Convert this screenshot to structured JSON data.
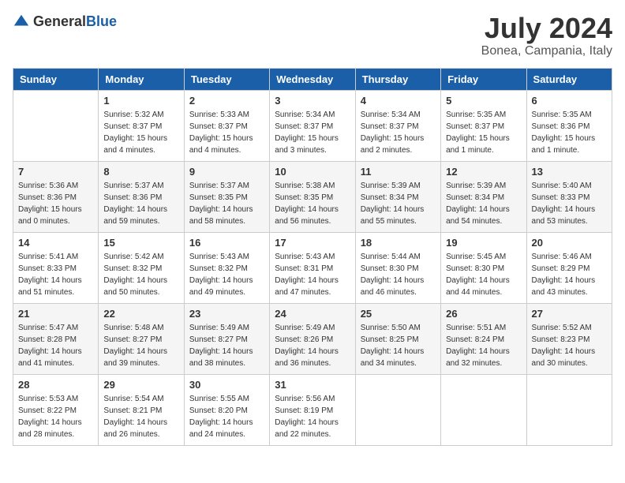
{
  "header": {
    "logo_general": "General",
    "logo_blue": "Blue",
    "month": "July 2024",
    "location": "Bonea, Campania, Italy"
  },
  "days_of_week": [
    "Sunday",
    "Monday",
    "Tuesday",
    "Wednesday",
    "Thursday",
    "Friday",
    "Saturday"
  ],
  "weeks": [
    [
      {
        "day": "",
        "sunrise": "",
        "sunset": "",
        "daylight": ""
      },
      {
        "day": "1",
        "sunrise": "Sunrise: 5:32 AM",
        "sunset": "Sunset: 8:37 PM",
        "daylight": "Daylight: 15 hours and 4 minutes."
      },
      {
        "day": "2",
        "sunrise": "Sunrise: 5:33 AM",
        "sunset": "Sunset: 8:37 PM",
        "daylight": "Daylight: 15 hours and 4 minutes."
      },
      {
        "day": "3",
        "sunrise": "Sunrise: 5:34 AM",
        "sunset": "Sunset: 8:37 PM",
        "daylight": "Daylight: 15 hours and 3 minutes."
      },
      {
        "day": "4",
        "sunrise": "Sunrise: 5:34 AM",
        "sunset": "Sunset: 8:37 PM",
        "daylight": "Daylight: 15 hours and 2 minutes."
      },
      {
        "day": "5",
        "sunrise": "Sunrise: 5:35 AM",
        "sunset": "Sunset: 8:37 PM",
        "daylight": "Daylight: 15 hours and 1 minute."
      },
      {
        "day": "6",
        "sunrise": "Sunrise: 5:35 AM",
        "sunset": "Sunset: 8:36 PM",
        "daylight": "Daylight: 15 hours and 1 minute."
      }
    ],
    [
      {
        "day": "7",
        "sunrise": "Sunrise: 5:36 AM",
        "sunset": "Sunset: 8:36 PM",
        "daylight": "Daylight: 15 hours and 0 minutes."
      },
      {
        "day": "8",
        "sunrise": "Sunrise: 5:37 AM",
        "sunset": "Sunset: 8:36 PM",
        "daylight": "Daylight: 14 hours and 59 minutes."
      },
      {
        "day": "9",
        "sunrise": "Sunrise: 5:37 AM",
        "sunset": "Sunset: 8:35 PM",
        "daylight": "Daylight: 14 hours and 58 minutes."
      },
      {
        "day": "10",
        "sunrise": "Sunrise: 5:38 AM",
        "sunset": "Sunset: 8:35 PM",
        "daylight": "Daylight: 14 hours and 56 minutes."
      },
      {
        "day": "11",
        "sunrise": "Sunrise: 5:39 AM",
        "sunset": "Sunset: 8:34 PM",
        "daylight": "Daylight: 14 hours and 55 minutes."
      },
      {
        "day": "12",
        "sunrise": "Sunrise: 5:39 AM",
        "sunset": "Sunset: 8:34 PM",
        "daylight": "Daylight: 14 hours and 54 minutes."
      },
      {
        "day": "13",
        "sunrise": "Sunrise: 5:40 AM",
        "sunset": "Sunset: 8:33 PM",
        "daylight": "Daylight: 14 hours and 53 minutes."
      }
    ],
    [
      {
        "day": "14",
        "sunrise": "Sunrise: 5:41 AM",
        "sunset": "Sunset: 8:33 PM",
        "daylight": "Daylight: 14 hours and 51 minutes."
      },
      {
        "day": "15",
        "sunrise": "Sunrise: 5:42 AM",
        "sunset": "Sunset: 8:32 PM",
        "daylight": "Daylight: 14 hours and 50 minutes."
      },
      {
        "day": "16",
        "sunrise": "Sunrise: 5:43 AM",
        "sunset": "Sunset: 8:32 PM",
        "daylight": "Daylight: 14 hours and 49 minutes."
      },
      {
        "day": "17",
        "sunrise": "Sunrise: 5:43 AM",
        "sunset": "Sunset: 8:31 PM",
        "daylight": "Daylight: 14 hours and 47 minutes."
      },
      {
        "day": "18",
        "sunrise": "Sunrise: 5:44 AM",
        "sunset": "Sunset: 8:30 PM",
        "daylight": "Daylight: 14 hours and 46 minutes."
      },
      {
        "day": "19",
        "sunrise": "Sunrise: 5:45 AM",
        "sunset": "Sunset: 8:30 PM",
        "daylight": "Daylight: 14 hours and 44 minutes."
      },
      {
        "day": "20",
        "sunrise": "Sunrise: 5:46 AM",
        "sunset": "Sunset: 8:29 PM",
        "daylight": "Daylight: 14 hours and 43 minutes."
      }
    ],
    [
      {
        "day": "21",
        "sunrise": "Sunrise: 5:47 AM",
        "sunset": "Sunset: 8:28 PM",
        "daylight": "Daylight: 14 hours and 41 minutes."
      },
      {
        "day": "22",
        "sunrise": "Sunrise: 5:48 AM",
        "sunset": "Sunset: 8:27 PM",
        "daylight": "Daylight: 14 hours and 39 minutes."
      },
      {
        "day": "23",
        "sunrise": "Sunrise: 5:49 AM",
        "sunset": "Sunset: 8:27 PM",
        "daylight": "Daylight: 14 hours and 38 minutes."
      },
      {
        "day": "24",
        "sunrise": "Sunrise: 5:49 AM",
        "sunset": "Sunset: 8:26 PM",
        "daylight": "Daylight: 14 hours and 36 minutes."
      },
      {
        "day": "25",
        "sunrise": "Sunrise: 5:50 AM",
        "sunset": "Sunset: 8:25 PM",
        "daylight": "Daylight: 14 hours and 34 minutes."
      },
      {
        "day": "26",
        "sunrise": "Sunrise: 5:51 AM",
        "sunset": "Sunset: 8:24 PM",
        "daylight": "Daylight: 14 hours and 32 minutes."
      },
      {
        "day": "27",
        "sunrise": "Sunrise: 5:52 AM",
        "sunset": "Sunset: 8:23 PM",
        "daylight": "Daylight: 14 hours and 30 minutes."
      }
    ],
    [
      {
        "day": "28",
        "sunrise": "Sunrise: 5:53 AM",
        "sunset": "Sunset: 8:22 PM",
        "daylight": "Daylight: 14 hours and 28 minutes."
      },
      {
        "day": "29",
        "sunrise": "Sunrise: 5:54 AM",
        "sunset": "Sunset: 8:21 PM",
        "daylight": "Daylight: 14 hours and 26 minutes."
      },
      {
        "day": "30",
        "sunrise": "Sunrise: 5:55 AM",
        "sunset": "Sunset: 8:20 PM",
        "daylight": "Daylight: 14 hours and 24 minutes."
      },
      {
        "day": "31",
        "sunrise": "Sunrise: 5:56 AM",
        "sunset": "Sunset: 8:19 PM",
        "daylight": "Daylight: 14 hours and 22 minutes."
      },
      {
        "day": "",
        "sunrise": "",
        "sunset": "",
        "daylight": ""
      },
      {
        "day": "",
        "sunrise": "",
        "sunset": "",
        "daylight": ""
      },
      {
        "day": "",
        "sunrise": "",
        "sunset": "",
        "daylight": ""
      }
    ]
  ]
}
